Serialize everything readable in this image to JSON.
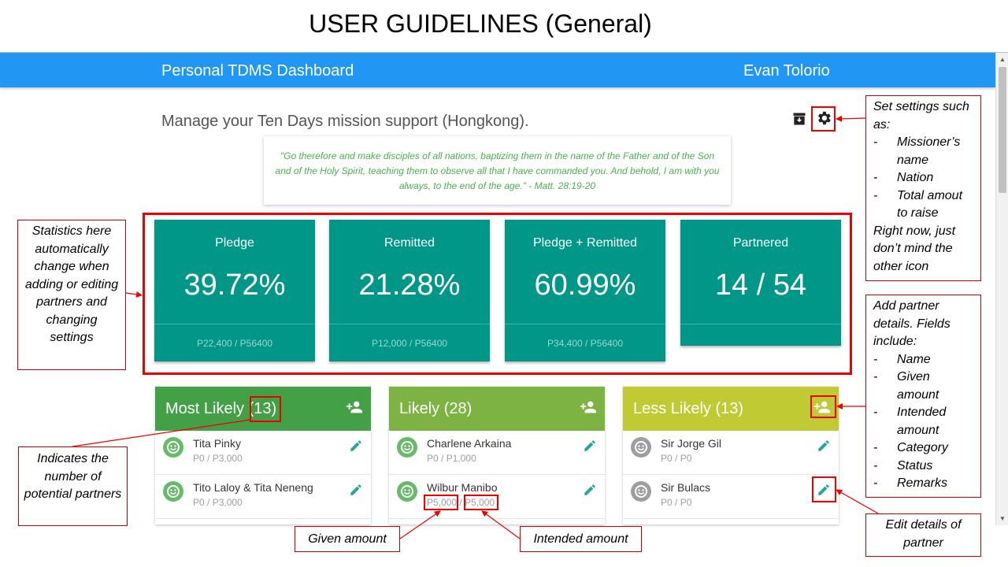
{
  "slide": {
    "title": "USER GUIDELINES (General)"
  },
  "appbar": {
    "brand": "Personal TDMS Dashboard",
    "user": "Evan Tolorio"
  },
  "page": {
    "heading": "Manage your Ten Days mission support (Hongkong)."
  },
  "icons": {
    "archive": "archive-icon",
    "settings": "gear-icon",
    "add_partner": "person-add-icon",
    "edit": "pencil-icon",
    "avatar": "smiley-avatar-icon"
  },
  "verse": {
    "text": "\"Go therefore and make disciples of all nations, baptizing them in the name of the Father and of the Son and of the Holy Spirit, teaching them to observe all that I have commanded you. And behold, I am with you always, to the end of the age.\" - Matt. 28:19-20"
  },
  "stats": [
    {
      "label": "Pledge",
      "value": "39.72%",
      "footer": "P22,400 / P56400"
    },
    {
      "label": "Remitted",
      "value": "21.28%",
      "footer": "P12,000 / P56400"
    },
    {
      "label": "Pledge + Remitted",
      "value": "60.99%",
      "footer": "P34,400 / P56400"
    },
    {
      "label": "Partnered",
      "value": "14 / 54",
      "footer": ""
    }
  ],
  "panels": [
    {
      "title": "Most Likely",
      "count": "(13)",
      "color": "#43a047",
      "partners": [
        {
          "name": "Tita Pinky",
          "given": "P0",
          "sep": " / ",
          "intended": "P3,000"
        },
        {
          "name": "Tito Laloy & Tita Neneng",
          "given": "P0",
          "sep": " / ",
          "intended": "P3,000"
        }
      ]
    },
    {
      "title": "Likely",
      "count": "(28)",
      "color": "#7cb342",
      "partners": [
        {
          "name": "Charlene Arkaina",
          "given": "P0",
          "sep": " / ",
          "intended": "P1,000"
        },
        {
          "name": "Wilbur Manibo",
          "given": "P5,000",
          "sep": " / ",
          "intended": "P5,000"
        }
      ]
    },
    {
      "title": "Less Likely",
      "count": "(13)",
      "color": "#c0ca33",
      "partners": [
        {
          "name": "Sir Jorge Gil",
          "given": "P0",
          "sep": " / ",
          "intended": "P0"
        },
        {
          "name": "Sir Bulacs",
          "given": "P0",
          "sep": " / ",
          "intended": "P0"
        }
      ]
    }
  ],
  "colors": {
    "appbar": "#2196f3",
    "stat": "#009688",
    "verse": "#4caf50",
    "annotation": "#e00000",
    "avatar_green": "#66bb6a",
    "avatar_grey": "#9e9e9e",
    "edit_icon": "#26a69a"
  },
  "callouts": {
    "settings": {
      "intro": "Set settings such as:",
      "items": [
        "Missioner’s name",
        "Nation",
        "Total amout to raise"
      ],
      "outro": "Right now, just don’t mind the other icon"
    },
    "stats": {
      "text": "Statistics here automatically change when adding or editing partners and changing settings"
    },
    "add_partner": {
      "intro": "Add partner details. Fields include:",
      "items": [
        "Name",
        "Given amount",
        "Intended amount",
        "Category",
        "Status",
        "Remarks"
      ]
    },
    "count": {
      "text": "Indicates the number of potential partners"
    },
    "given": {
      "text": "Given amount"
    },
    "intended": {
      "text": "Intended amount"
    },
    "edit": {
      "text": "Edit details of partner"
    }
  }
}
